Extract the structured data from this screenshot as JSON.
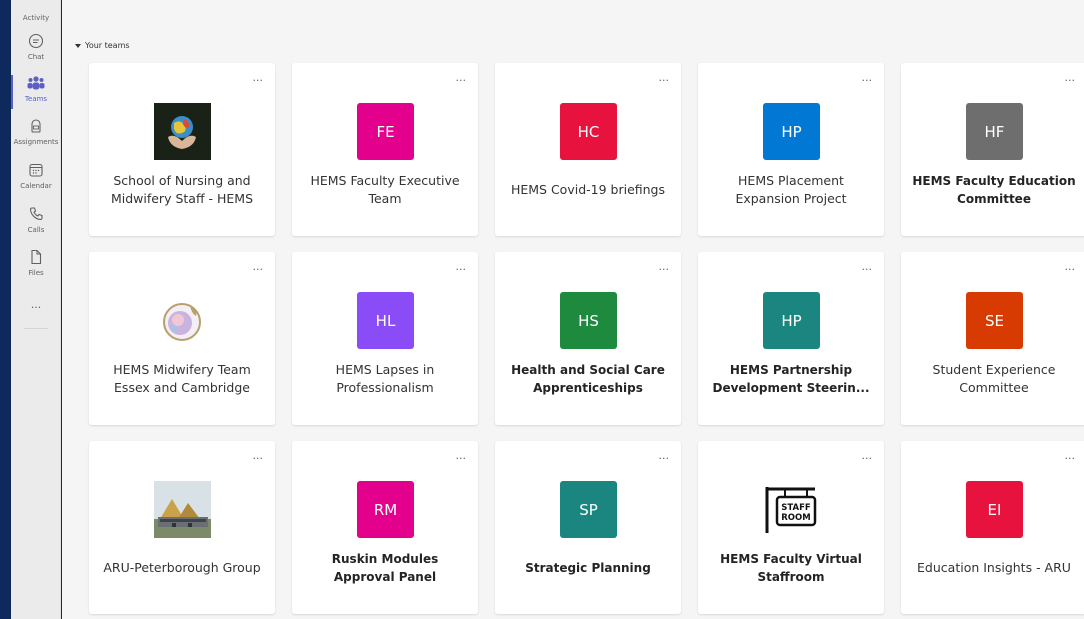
{
  "rail": {
    "items": [
      {
        "label": "Activity",
        "icon": "bell-icon"
      },
      {
        "label": "Chat",
        "icon": "chat-icon"
      },
      {
        "label": "Teams",
        "icon": "teams-icon",
        "active": true
      },
      {
        "label": "Assignments",
        "icon": "assignments-icon"
      },
      {
        "label": "Calendar",
        "icon": "calendar-icon"
      },
      {
        "label": "Calls",
        "icon": "phone-icon"
      },
      {
        "label": "Files",
        "icon": "file-icon"
      }
    ],
    "more": "..."
  },
  "section_title": "Your teams",
  "more_glyph": "...",
  "teams": [
    {
      "name": "School of Nursing and Midwifery Staff - HEMS",
      "initials": "",
      "avatar": "globe-hands-image",
      "bold": false
    },
    {
      "name": "HEMS Faculty Executive Team",
      "initials": "FE",
      "color": "#e3008c",
      "bold": false
    },
    {
      "name": "HEMS Covid-19 briefings",
      "initials": "HC",
      "color": "#e8123e",
      "bold": false
    },
    {
      "name": "HEMS Placement Expansion Project",
      "initials": "HP",
      "color": "#0078d4",
      "bold": false
    },
    {
      "name": "HEMS Faculty Education Committee",
      "initials": "HF",
      "color": "#6e6e6e",
      "bold": true
    },
    {
      "name": "HEMS Midwifery Team Essex and Cambridge",
      "initials": "",
      "avatar": "midwifery-logo-image",
      "bold": false
    },
    {
      "name": "HEMS Lapses in Professionalism",
      "initials": "HL",
      "color": "#8a4cf6",
      "bold": false
    },
    {
      "name": "Health and Social Care Apprenticeships",
      "initials": "HS",
      "color": "#1e8a3d",
      "bold": true
    },
    {
      "name": "HEMS Partnership Development Steerin...",
      "initials": "HP",
      "color": "#1b8680",
      "bold": true
    },
    {
      "name": "Student Experience Committee",
      "initials": "SE",
      "color": "#d83b01",
      "bold": false
    },
    {
      "name": "ARU-Peterborough Group",
      "initials": "",
      "avatar": "building-photo-image",
      "bold": false
    },
    {
      "name": "Ruskin Modules Approval Panel",
      "initials": "RM",
      "color": "#e3008c",
      "bold": true
    },
    {
      "name": "Strategic Planning",
      "initials": "SP",
      "color": "#1b8680",
      "bold": true
    },
    {
      "name": "HEMS Faculty Virtual Staffroom",
      "initials": "",
      "avatar": "staff-room-sign-icon",
      "sign_text": [
        "STAFF",
        "ROOM"
      ],
      "bold": true
    },
    {
      "name": "Education Insights - ARU",
      "initials": "EI",
      "color": "#e8123e",
      "bold": false
    }
  ]
}
